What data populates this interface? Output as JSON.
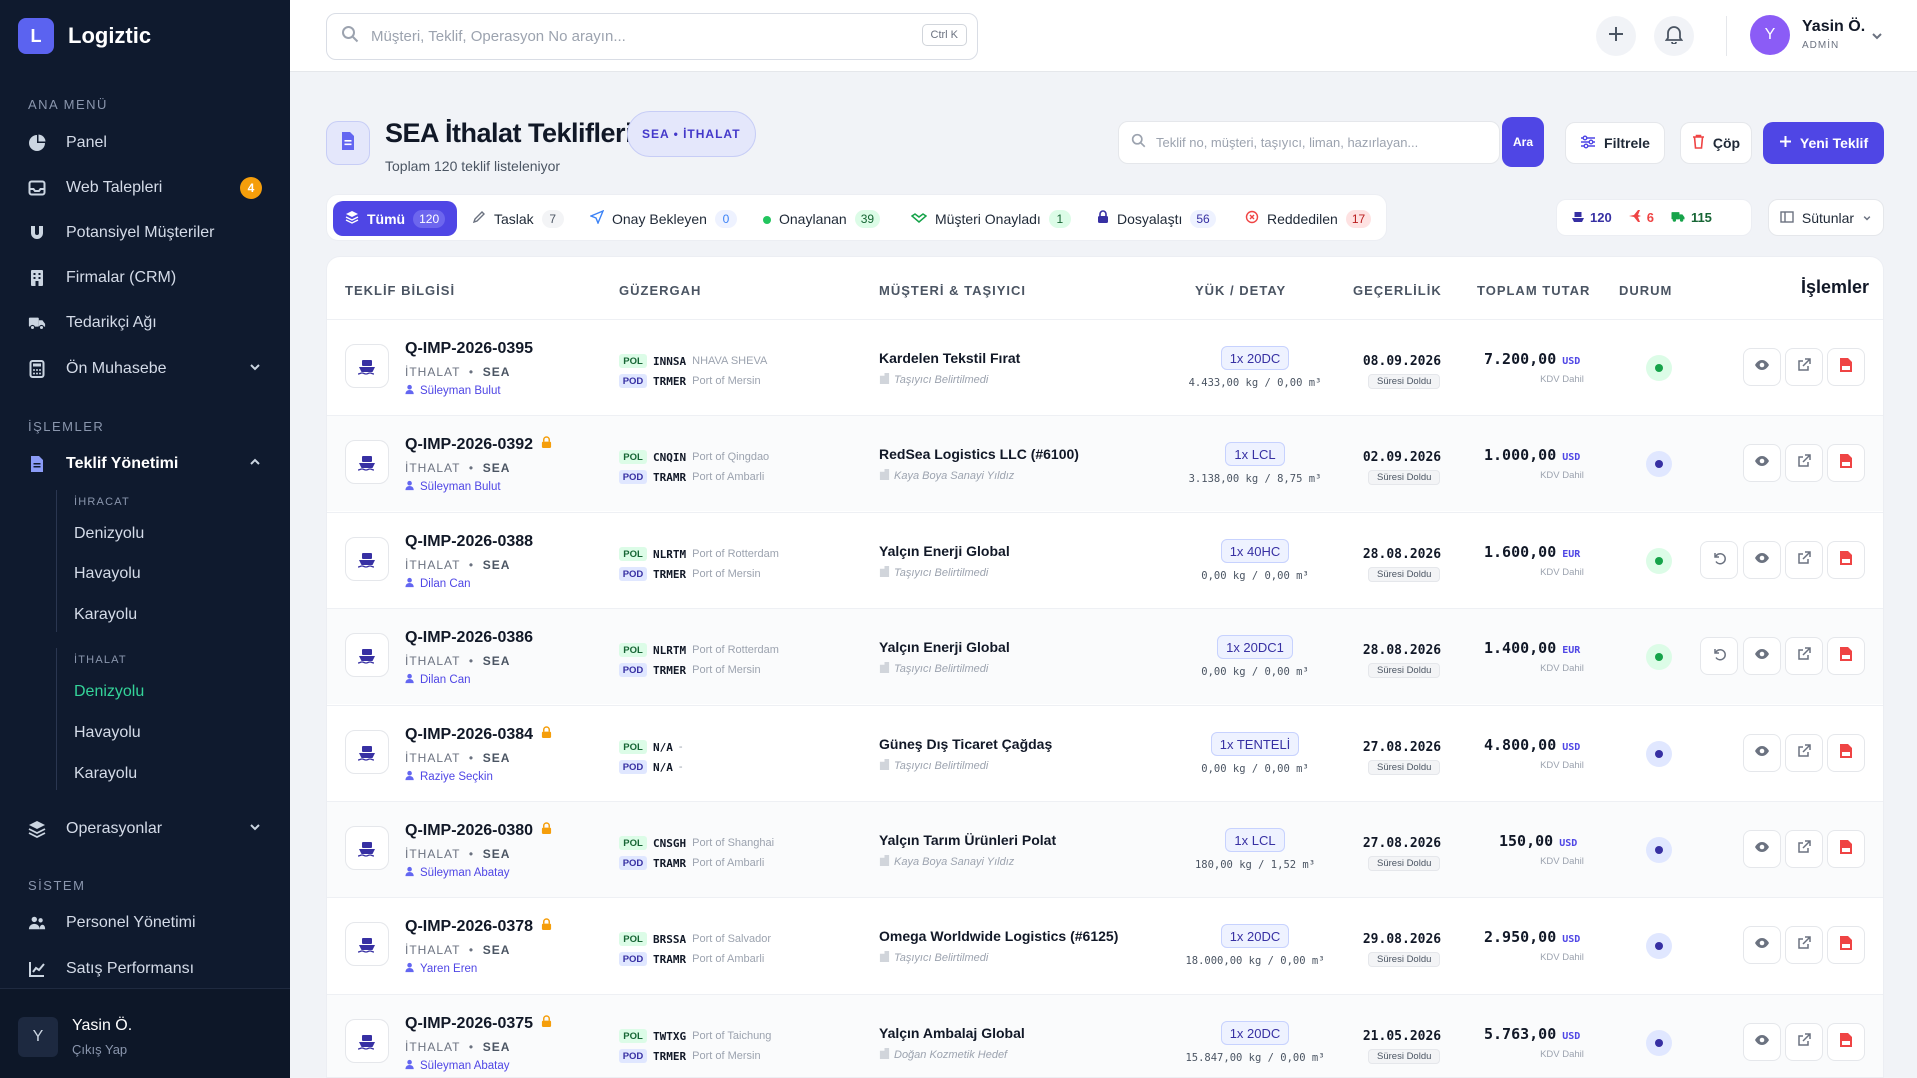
{
  "brand": {
    "logo_letter": "L",
    "name": "Logiztic"
  },
  "sidebar": {
    "section_main": "ANA MENÜ",
    "main_items": [
      {
        "label": "Panel",
        "icon": "pie-chart-icon"
      },
      {
        "label": "Web Talepleri",
        "icon": "inbox-icon",
        "badge": "4"
      },
      {
        "label": "Potansiyel Müşteriler",
        "icon": "magnet-icon"
      },
      {
        "label": "Firmalar (CRM)",
        "icon": "building-icon"
      },
      {
        "label": "Tedarikçi Ağı",
        "icon": "truck-icon"
      },
      {
        "label": "Ön Muhasebe",
        "icon": "calculator-icon"
      }
    ],
    "section_ops": "İŞLEMLER",
    "teklif_label": "Teklif Yönetimi",
    "ihracat_label": "İHRACAT",
    "ihracat_items": [
      "Denizyolu",
      "Havayolu",
      "Karayolu"
    ],
    "ithalat_label": "İTHALAT",
    "ithalat_items": [
      "Denizyolu",
      "Havayolu",
      "Karayolu"
    ],
    "operasyonlar_label": "Operasyonlar",
    "section_system": "SİSTEM",
    "system_items": [
      {
        "label": "Personel Yönetimi",
        "icon": "users-icon"
      },
      {
        "label": "Satış Performansı",
        "icon": "line-chart-icon"
      }
    ],
    "user": {
      "initial": "Y",
      "name": "Yasin Ö.",
      "logout": "Çıkış Yap"
    }
  },
  "topbar": {
    "search_placeholder": "Müşteri, Teklif, Operasyon No arayın...",
    "shortcut": "Ctrl K",
    "user": {
      "initial": "Y",
      "name": "Yasin Ö.",
      "role": "ADMİN"
    }
  },
  "page": {
    "title": "SEA İthalat Teklifleri",
    "badge": "SEA • İTHALAT",
    "subtitle": "Toplam 120 teklif listeleniyor",
    "search_placeholder": "Teklif no, müşteri, taşıyıcı, liman, hazırlayan...",
    "search_button": "Ara",
    "filter_button": "Filtrele",
    "trash_button": "Çöp",
    "new_button": "Yeni Teklif",
    "columns_button": "Sütunlar"
  },
  "tabs": [
    {
      "label": "Tümü",
      "count": "120"
    },
    {
      "label": "Taslak",
      "count": "7"
    },
    {
      "label": "Onay Bekleyen",
      "count": "0"
    },
    {
      "label": "Onaylanan",
      "count": "39"
    },
    {
      "label": "Müşteri Onayladı",
      "count": "1"
    },
    {
      "label": "Dosyalaştı",
      "count": "56"
    },
    {
      "label": "Reddedilen",
      "count": "17"
    }
  ],
  "stats": {
    "ship": "120",
    "plane": "6",
    "truck": "115"
  },
  "table": {
    "headers": {
      "info": "TEKLİF BİLGİSİ",
      "route": "GÜZERGAH",
      "customer": "MÜŞTERİ & TAŞIYICI",
      "load": "YÜK / DETAY",
      "validity": "GEÇERLİLİK",
      "total": "TOPLAM TUTAR",
      "status": "DURUM",
      "actions": "İşlemler"
    },
    "rows": [
      {
        "no": "Q-IMP-2026-0395",
        "locked": false,
        "dir": "İTHALAT",
        "mode": "SEA",
        "by": "Süleyman Bulut",
        "pol_code": "INNSA",
        "pol_name": "NHAVA SHEVA",
        "pod_code": "TRMER",
        "pod_name": "Port of Mersin",
        "customer": "Kardelen Tekstil Fırat",
        "carrier": "Taşıyıcı Belirtilmedi",
        "container": "1x 20DC",
        "weight": "4.433,00 kg  /  0,00 m³",
        "date": "08.09.2026",
        "expired": "Süresi Doldu",
        "amount": "7.200,00",
        "currency": "USD",
        "vat": "KDV Dahil",
        "status": "approved",
        "revert": false
      },
      {
        "no": "Q-IMP-2026-0392",
        "locked": true,
        "dir": "İTHALAT",
        "mode": "SEA",
        "by": "Süleyman Bulut",
        "pol_code": "CNQIN",
        "pol_name": "Port of Qingdao",
        "pod_code": "TRAMR",
        "pod_name": "Port of Ambarli",
        "customer": "RedSea Logistics LLC (#6100)",
        "carrier": "Kaya Boya Sanayi Yıldız",
        "container": "1x LCL",
        "weight": "3.138,00 kg  /  8,75 m³",
        "date": "02.09.2026",
        "expired": "Süresi Doldu",
        "amount": "1.000,00",
        "currency": "USD",
        "vat": "KDV Dahil",
        "status": "filed",
        "revert": false
      },
      {
        "no": "Q-IMP-2026-0388",
        "locked": false,
        "dir": "İTHALAT",
        "mode": "SEA",
        "by": "Dilan Can",
        "pol_code": "NLRTM",
        "pol_name": "Port of Rotterdam",
        "pod_code": "TRMER",
        "pod_name": "Port of Mersin",
        "customer": "Yalçın Enerji Global",
        "carrier": "Taşıyıcı Belirtilmedi",
        "container": "1x 40HC",
        "weight": "0,00 kg  /  0,00 m³",
        "date": "28.08.2026",
        "expired": "Süresi Doldu",
        "amount": "1.600,00",
        "currency": "EUR",
        "vat": "KDV Dahil",
        "status": "approved",
        "revert": true
      },
      {
        "no": "Q-IMP-2026-0386",
        "locked": false,
        "dir": "İTHALAT",
        "mode": "SEA",
        "by": "Dilan Can",
        "pol_code": "NLRTM",
        "pol_name": "Port of Rotterdam",
        "pod_code": "TRMER",
        "pod_name": "Port of Mersin",
        "customer": "Yalçın Enerji Global",
        "carrier": "Taşıyıcı Belirtilmedi",
        "container": "1x 20DC1",
        "weight": "0,00 kg  /  0,00 m³",
        "date": "28.08.2026",
        "expired": "Süresi Doldu",
        "amount": "1.400,00",
        "currency": "EUR",
        "vat": "KDV Dahil",
        "status": "approved",
        "revert": true
      },
      {
        "no": "Q-IMP-2026-0384",
        "locked": true,
        "dir": "İTHALAT",
        "mode": "SEA",
        "by": "Raziye Seçkin",
        "pol_code": "N/A",
        "pol_name": "-",
        "pod_code": "N/A",
        "pod_name": "-",
        "customer": "Güneş Dış Ticaret Çağdaş",
        "carrier": "Taşıyıcı Belirtilmedi",
        "container": "1x TENTELİ",
        "weight": "0,00 kg  /  0,00 m³",
        "date": "27.08.2026",
        "expired": "Süresi Doldu",
        "amount": "4.800,00",
        "currency": "USD",
        "vat": "KDV Dahil",
        "status": "filed",
        "revert": false
      },
      {
        "no": "Q-IMP-2026-0380",
        "locked": true,
        "dir": "İTHALAT",
        "mode": "SEA",
        "by": "Süleyman Abatay",
        "pol_code": "CNSGH",
        "pol_name": "Port of Shanghai",
        "pod_code": "TRAMR",
        "pod_name": "Port of Ambarli",
        "customer": "Yalçın Tarım Ürünleri Polat",
        "carrier": "Kaya Boya Sanayi Yıldız",
        "container": "1x LCL",
        "weight": "180,00 kg  /  1,52 m³",
        "date": "27.08.2026",
        "expired": "Süresi Doldu",
        "amount": "150,00",
        "currency": "USD",
        "vat": "KDV Dahil",
        "status": "filed",
        "revert": false
      },
      {
        "no": "Q-IMP-2026-0378",
        "locked": true,
        "dir": "İTHALAT",
        "mode": "SEA",
        "by": "Yaren Eren",
        "pol_code": "BRSSA",
        "pol_name": "Port of Salvador",
        "pod_code": "TRAMR",
        "pod_name": "Port of Ambarli",
        "customer": "Omega Worldwide Logistics (#6125)",
        "carrier": "Taşıyıcı Belirtilmedi",
        "container": "1x 20DC",
        "weight": "18.000,00 kg  /  0,00 m³",
        "date": "29.08.2026",
        "expired": "Süresi Doldu",
        "amount": "2.950,00",
        "currency": "USD",
        "vat": "KDV Dahil",
        "status": "filed",
        "revert": false
      },
      {
        "no": "Q-IMP-2026-0375",
        "locked": true,
        "dir": "İTHALAT",
        "mode": "SEA",
        "by": "Süleyman Abatay",
        "pol_code": "TWTXG",
        "pol_name": "Port of Taichung",
        "pod_code": "TRMER",
        "pod_name": "Port of Mersin",
        "customer": "Yalçın Ambalaj Global",
        "carrier": "Doğan Kozmetik Hedef",
        "container": "1x 20DC",
        "weight": "15.847,00 kg  /  0,00 m³",
        "date": "21.05.2026",
        "expired": "Süresi Doldu",
        "amount": "5.763,00",
        "currency": "USD",
        "vat": "KDV Dahil",
        "status": "filed",
        "revert": false
      }
    ]
  },
  "colors": {
    "accent": "#4f46e5",
    "sidebar_bg": "#0f1a2e",
    "active_green": "#34d399",
    "approved": "#16a34a",
    "filed": "#3730a3"
  }
}
